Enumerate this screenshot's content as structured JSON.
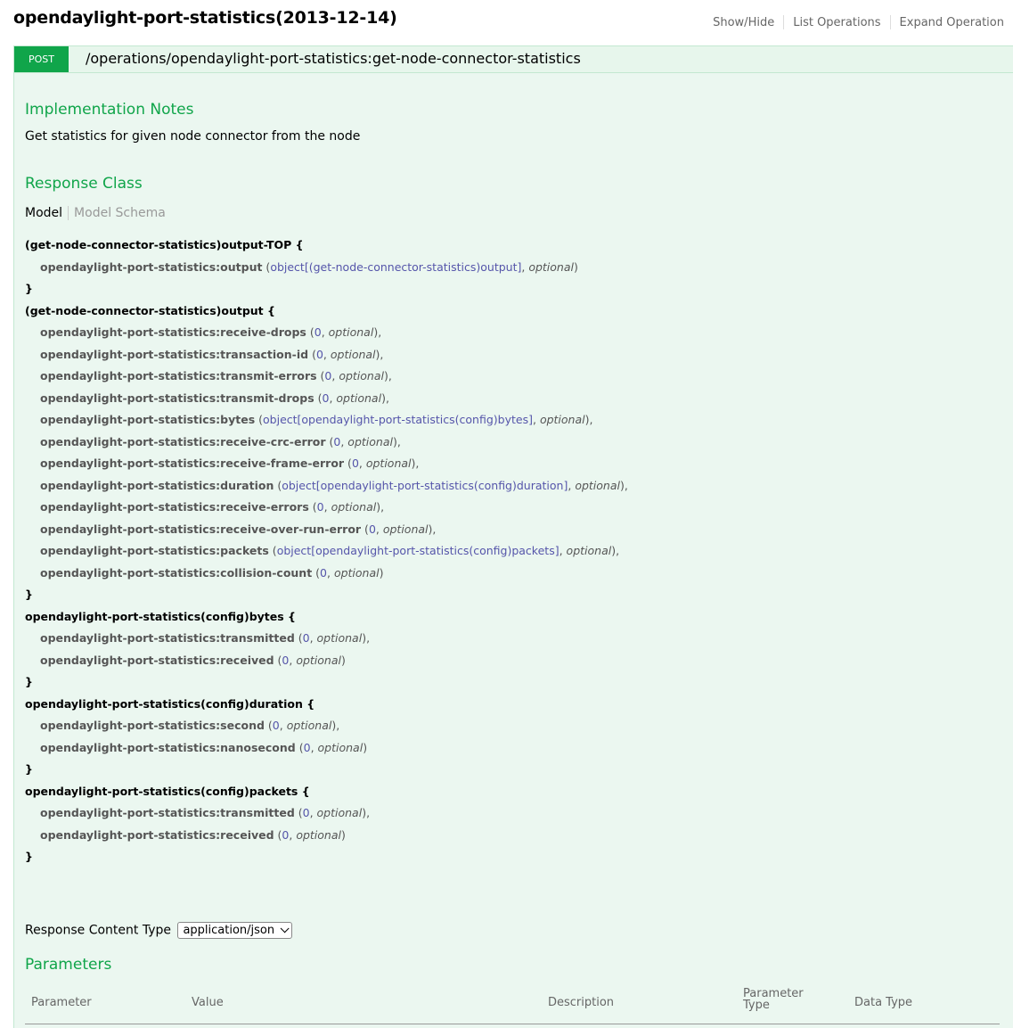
{
  "api": {
    "title": "opendaylight-port-statistics(2013-12-14)"
  },
  "top_links": {
    "show_hide": "Show/Hide",
    "list_operations": "List Operations",
    "expand_operation": "Expand Operation"
  },
  "operation": {
    "method": "POST",
    "path": "/operations/opendaylight-port-statistics:get-node-connector-statistics"
  },
  "implementation_notes": {
    "heading": "Implementation Notes",
    "text": "Get statistics for given node connector from the node"
  },
  "response_class": {
    "heading": "Response Class",
    "tab_model": "Model",
    "tab_schema": "Model Schema"
  },
  "signature": [
    {
      "kind": "head",
      "text": "(get-node-connector-statistics)output-TOP {"
    },
    {
      "kind": "prop",
      "name": "opendaylight-port-statistics:output",
      "type": "object[(get-node-connector-statistics)output]",
      "opt": "optional",
      "trail": ")"
    },
    {
      "kind": "head",
      "text": "}"
    },
    {
      "kind": "head",
      "text": "(get-node-connector-statistics)output {"
    },
    {
      "kind": "prop",
      "name": "opendaylight-port-statistics:receive-drops",
      "type": "0",
      "opt": "optional",
      "trail": "),"
    },
    {
      "kind": "prop",
      "name": "opendaylight-port-statistics:transaction-id",
      "type": "0",
      "opt": "optional",
      "trail": "),"
    },
    {
      "kind": "prop",
      "name": "opendaylight-port-statistics:transmit-errors",
      "type": "0",
      "opt": "optional",
      "trail": "),"
    },
    {
      "kind": "prop",
      "name": "opendaylight-port-statistics:transmit-drops",
      "type": "0",
      "opt": "optional",
      "trail": "),"
    },
    {
      "kind": "prop",
      "name": "opendaylight-port-statistics:bytes",
      "type": "object[opendaylight-port-statistics(config)bytes]",
      "opt": "optional",
      "trail": "),"
    },
    {
      "kind": "prop",
      "name": "opendaylight-port-statistics:receive-crc-error",
      "type": "0",
      "opt": "optional",
      "trail": "),"
    },
    {
      "kind": "prop",
      "name": "opendaylight-port-statistics:receive-frame-error",
      "type": "0",
      "opt": "optional",
      "trail": "),"
    },
    {
      "kind": "prop",
      "name": "opendaylight-port-statistics:duration",
      "type": "object[opendaylight-port-statistics(config)duration]",
      "opt": "optional",
      "trail": "),"
    },
    {
      "kind": "prop",
      "name": "opendaylight-port-statistics:receive-errors",
      "type": "0",
      "opt": "optional",
      "trail": "),"
    },
    {
      "kind": "prop",
      "name": "opendaylight-port-statistics:receive-over-run-error",
      "type": "0",
      "opt": "optional",
      "trail": "),"
    },
    {
      "kind": "prop",
      "name": "opendaylight-port-statistics:packets",
      "type": "object[opendaylight-port-statistics(config)packets]",
      "opt": "optional",
      "trail": "),"
    },
    {
      "kind": "prop",
      "name": "opendaylight-port-statistics:collision-count",
      "type": "0",
      "opt": "optional",
      "trail": ")"
    },
    {
      "kind": "head",
      "text": "}"
    },
    {
      "kind": "head",
      "text": "opendaylight-port-statistics(config)bytes {"
    },
    {
      "kind": "prop",
      "name": "opendaylight-port-statistics:transmitted",
      "type": "0",
      "opt": "optional",
      "trail": "),"
    },
    {
      "kind": "prop",
      "name": "opendaylight-port-statistics:received",
      "type": "0",
      "opt": "optional",
      "trail": ")"
    },
    {
      "kind": "head",
      "text": "}"
    },
    {
      "kind": "head",
      "text": "opendaylight-port-statistics(config)duration {"
    },
    {
      "kind": "prop",
      "name": "opendaylight-port-statistics:second",
      "type": "0",
      "opt": "optional",
      "trail": "),"
    },
    {
      "kind": "prop",
      "name": "opendaylight-port-statistics:nanosecond",
      "type": "0",
      "opt": "optional",
      "trail": ")"
    },
    {
      "kind": "head",
      "text": "}"
    },
    {
      "kind": "head",
      "text": "opendaylight-port-statistics(config)packets {"
    },
    {
      "kind": "prop",
      "name": "opendaylight-port-statistics:transmitted",
      "type": "0",
      "opt": "optional",
      "trail": "),"
    },
    {
      "kind": "prop",
      "name": "opendaylight-port-statistics:received",
      "type": "0",
      "opt": "optional",
      "trail": ")"
    },
    {
      "kind": "head",
      "text": "}"
    }
  ],
  "response_content_type": {
    "label": "Response Content Type",
    "value": "application/json"
  },
  "parameters": {
    "heading": "Parameters",
    "columns": {
      "parameter": "Parameter",
      "value": "Value",
      "description": "Description",
      "param_type_1": "Parameter",
      "param_type_2": "Type",
      "data_type": "Data Type"
    }
  }
}
